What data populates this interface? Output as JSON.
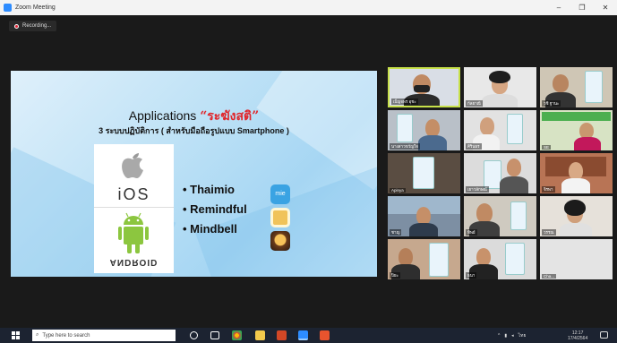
{
  "window": {
    "title": "Zoom Meeting",
    "minimize_glyph": "–",
    "restore_glyph": "❐",
    "close_glyph": "✕"
  },
  "recording": {
    "label": "Recording..."
  },
  "slide": {
    "title_en": "Applications",
    "title_th": "“ระฆังสติ”",
    "subtitle": "3 ระบบปฏิบัติการ ( สำหรับมือถือรูปแบบ Smartphone )",
    "ios_label": "iOS",
    "android_label": "ANDROID",
    "apps": [
      "• Thaimio",
      "• Remindful",
      "• Mindbell"
    ],
    "app_icon_labels": [
      "mie",
      "",
      ""
    ]
  },
  "participants": [
    {
      "name": "เบ็ญจพร อุชะ"
    },
    {
      "name": "กัลยาณี"
    },
    {
      "name": "วชิ ฐานะ"
    },
    {
      "name": "นางสาวขวัญใจ"
    },
    {
      "name": "ศิรินธร"
    },
    {
      "name": "SE"
    },
    {
      "name": "Apinya"
    },
    {
      "name": "เยาวลักษณ์"
    },
    {
      "name": "จิรพา"
    },
    {
      "name": "ชาญ"
    },
    {
      "name": "ทิพย์"
    },
    {
      "name": "วรรณ"
    },
    {
      "name": "ปิยะ"
    },
    {
      "name": "ธนา"
    },
    {
      "name": "Cha..."
    }
  ],
  "taskbar": {
    "search_placeholder": "Type here to search",
    "time": "12:17",
    "date": "17/4/2564",
    "language": "ไทย"
  },
  "colors": {
    "accent": "#2d8cff",
    "slide_title_th": "#e0262b",
    "active_speaker_border": "#c7e04a"
  }
}
